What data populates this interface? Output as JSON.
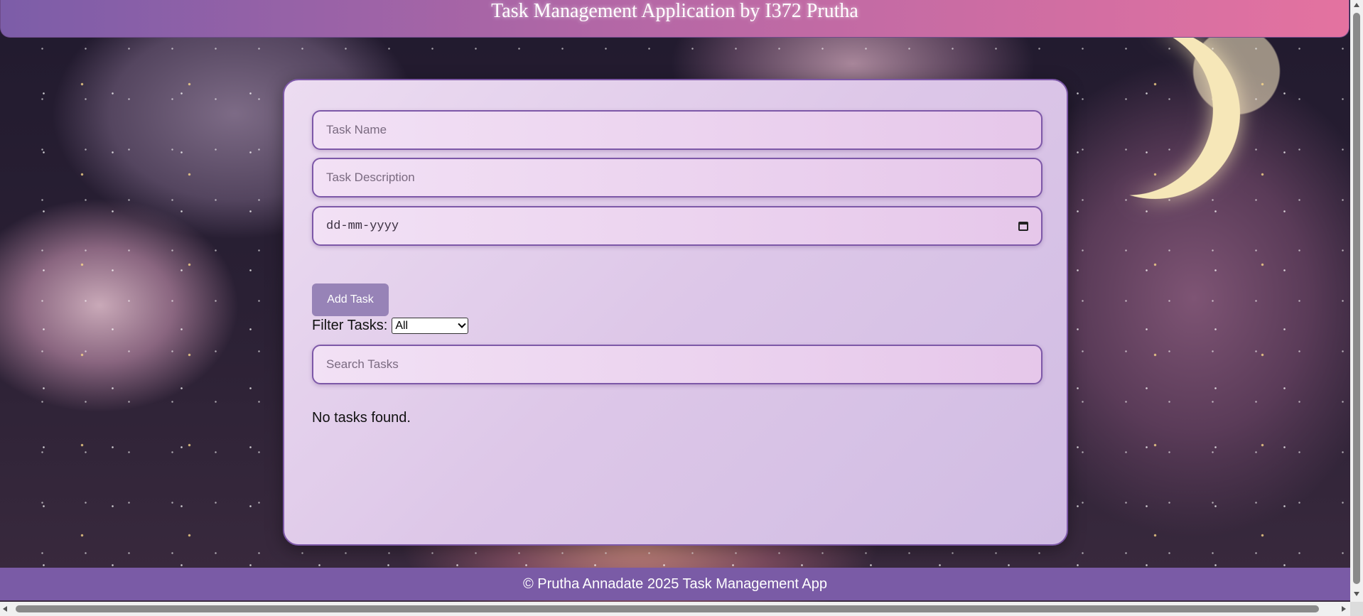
{
  "header": {
    "title": "Task Management Application by I372 Prutha"
  },
  "form": {
    "task_name_placeholder": "Task Name",
    "task_description_placeholder": "Task Description",
    "date_placeholder": "dd-mm-yyyy",
    "date_icon": "calendar-icon",
    "add_button_label": "Add Task"
  },
  "filter": {
    "label": "Filter Tasks:",
    "selected": "All"
  },
  "search": {
    "placeholder": "Search Tasks"
  },
  "tasks": {
    "empty_message": "No tasks found."
  },
  "footer": {
    "text": "© Prutha Annadate 2025 Task Management App"
  },
  "colors": {
    "accent": "#7d58a8",
    "button": "#9783b7",
    "footer": "#7a5ba6",
    "header_gradient_start": "#7c5da8",
    "header_gradient_end": "#e472a0"
  }
}
